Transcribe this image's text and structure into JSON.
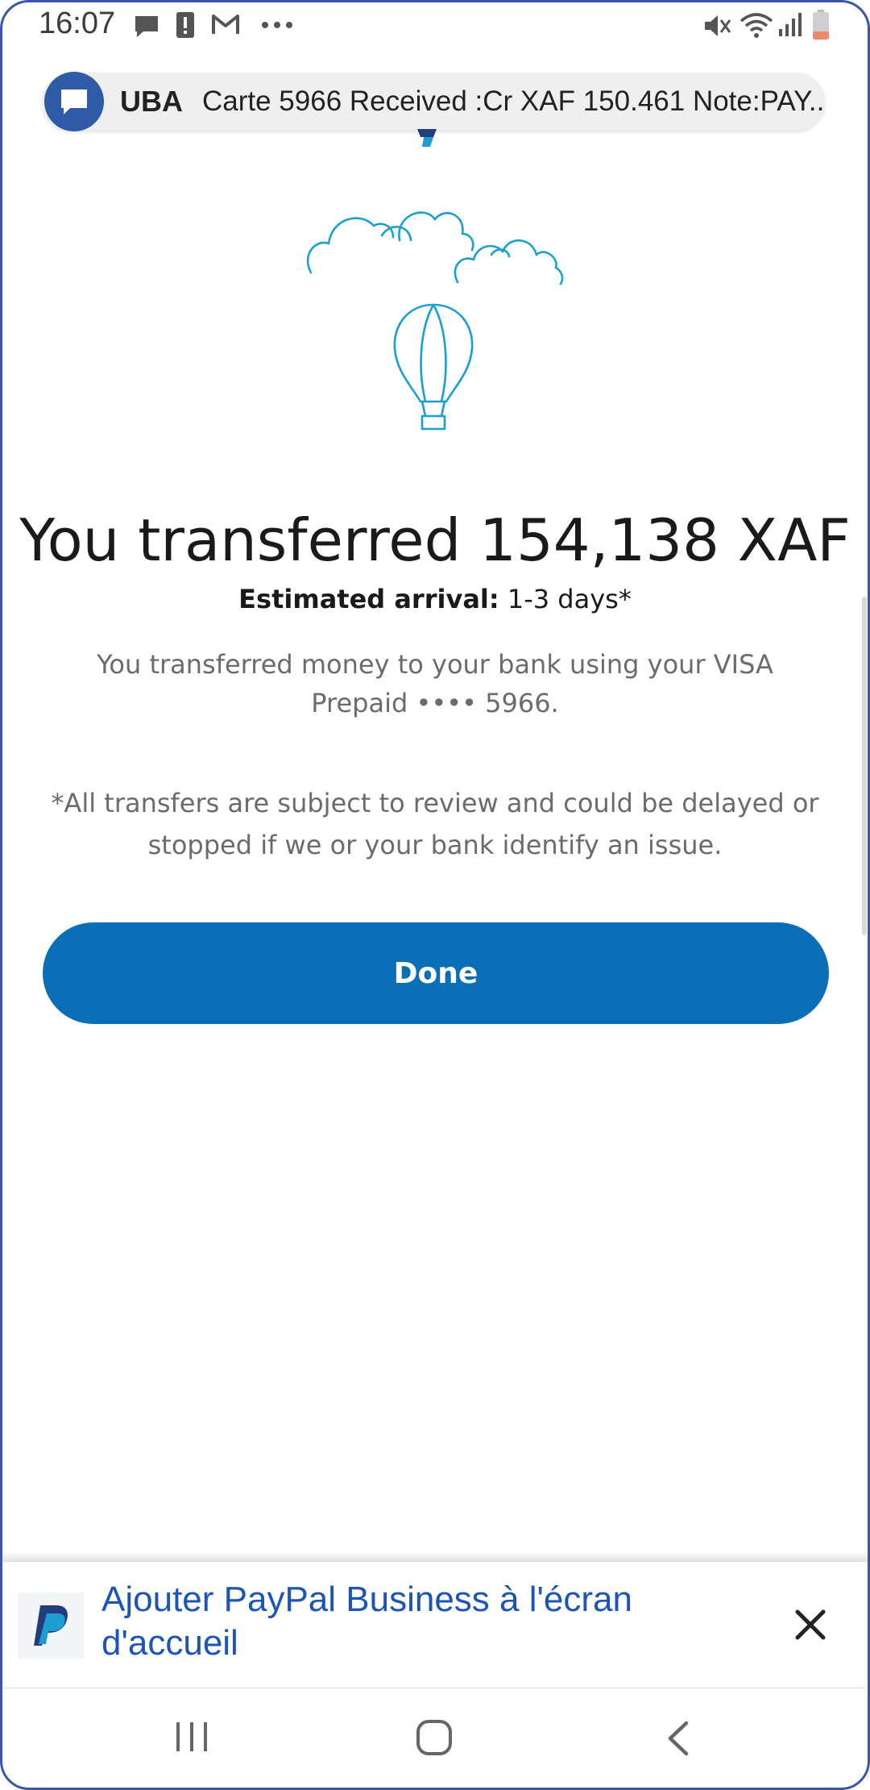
{
  "status_bar": {
    "time": "16:07",
    "icons": [
      "message-icon",
      "alert-icon",
      "gmail-icon",
      "more-dots-icon",
      "mute-icon",
      "wifi-icon",
      "signal-icon",
      "battery-icon"
    ]
  },
  "notification": {
    "app": "UBA",
    "text": "Carte 5966 Received :Cr  XAF 150.461 Note:PAY..."
  },
  "main": {
    "headline": "You transferred 154,138 XAF",
    "arrival_label": "Estimated arrival:",
    "arrival_value": "1-3 days*",
    "description": "You transferred money to your bank using your VISA Prepaid •••• 5966.",
    "disclaimer": "*All transfers are subject to review and could be delayed or stopped if we or your bank identify an issue.",
    "done_label": "Done"
  },
  "banner": {
    "text": "Ajouter PayPal Business à l'écran d'accueil"
  },
  "colors": {
    "accent": "#0b6fb7",
    "illustration": "#1a9fd0",
    "banner_link": "#1d55b4"
  }
}
